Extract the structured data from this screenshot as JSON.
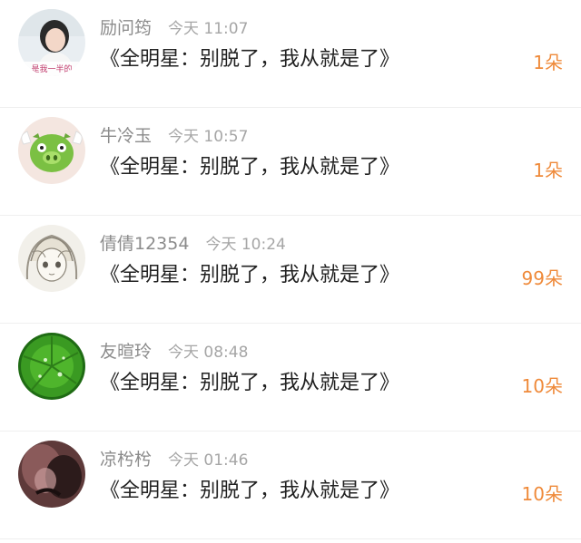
{
  "colors": {
    "name": "#8b8b8b",
    "time": "#a6a6a6",
    "message": "#222222",
    "count_accent": "#ef8a3a",
    "divider": "#efefef"
  },
  "comments": [
    {
      "avatar_icon": "girl-photo-avatar",
      "avatar_caption": "是我一半的",
      "name": "励问筠",
      "time": "今天 11:07",
      "message": "《全明星：别脱了，我从就是了》",
      "count": "1朵"
    },
    {
      "avatar_icon": "green-pig-avatar",
      "name": "牛冷玉",
      "time": "今天 10:57",
      "message": "《全明星：别脱了，我从就是了》",
      "count": "1朵"
    },
    {
      "avatar_icon": "anime-sketch-avatar",
      "name": "倩倩12354",
      "time": "今天 10:24",
      "message": "《全明星：别脱了，我从就是了》",
      "count": "99朵"
    },
    {
      "avatar_icon": "green-leaf-avatar",
      "name": "友暄玲",
      "time": "今天 08:48",
      "message": "《全明星：别脱了，我从就是了》",
      "count": "10朵"
    },
    {
      "avatar_icon": "dark-photo-avatar",
      "name": "凉枍枍",
      "time": "今天 01:46",
      "message": "《全明星：别脱了，我从就是了》",
      "count": "10朵"
    }
  ]
}
